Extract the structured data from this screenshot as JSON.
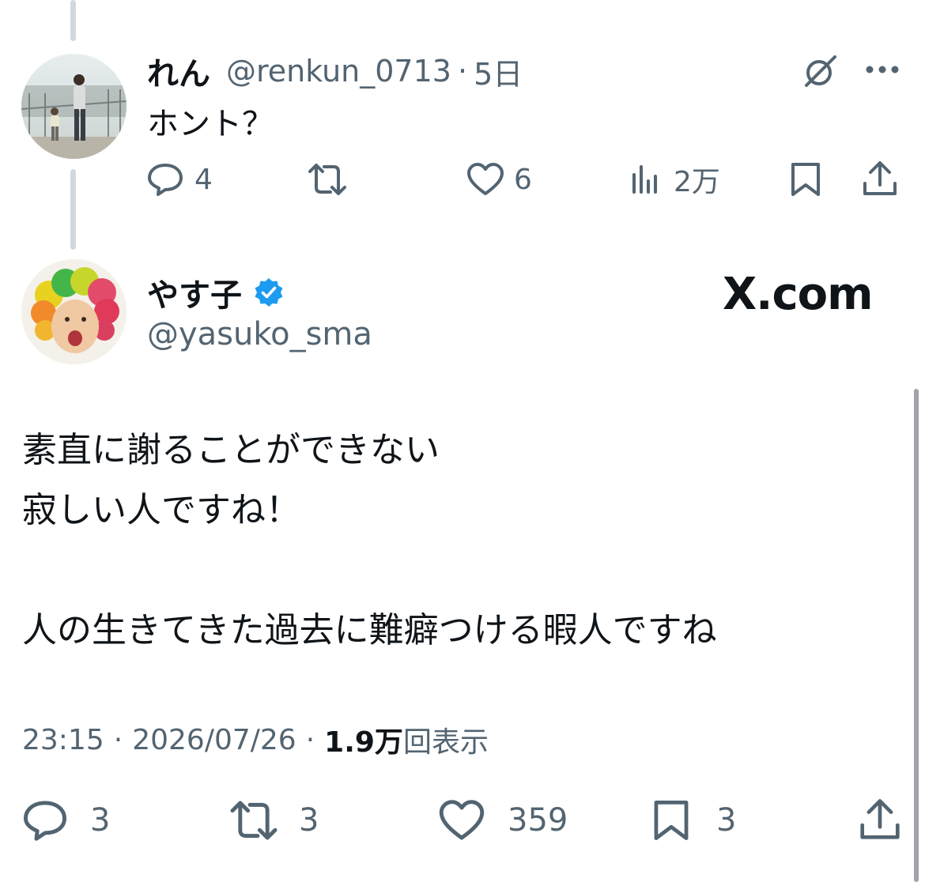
{
  "reply": {
    "display_name": "れん",
    "handle": "@renkun_0713",
    "separator": "·",
    "age": "5日",
    "text": "ホント？",
    "avatar_icon": "avatar-photo",
    "actions": {
      "reply_count": "4",
      "retweet_count": "",
      "like_count": "6",
      "views_count": "2万"
    }
  },
  "main": {
    "display_name": "やす子",
    "handle": "@yasuko_sma",
    "verified_icon": "verified-badge-icon",
    "watermark": "X.com",
    "text_lines": [
      "素直に謝ることができない",
      "寂しい人ですね！",
      "",
      "人の生きてきた過去に難癖つける暇人ですね"
    ],
    "meta": {
      "time": "23:15",
      "sep1": "·",
      "date": "2026/07/26",
      "sep2": "·",
      "views_number": "1.9万",
      "views_label": "回表示"
    },
    "actions": {
      "reply_count": "3",
      "retweet_count": "3",
      "like_count": "359",
      "bookmark_count": "3"
    }
  },
  "colors": {
    "accent": "#1d9bf0",
    "muted": "#536471",
    "thread_line": "#cfd9de"
  }
}
